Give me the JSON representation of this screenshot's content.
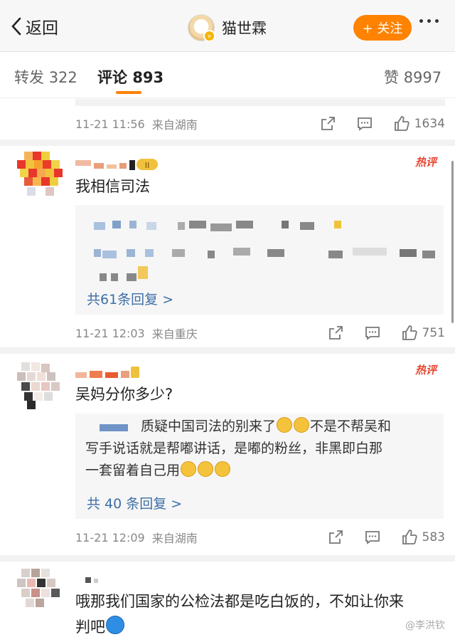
{
  "header": {
    "back_label": "返回",
    "user_name": "猫世霖",
    "follow_label": "+ 关注"
  },
  "tabs": {
    "repost_label": "转发",
    "repost_count": "322",
    "comment_label": "评论",
    "comment_count": "893",
    "like_label": "赞",
    "like_count": "8997"
  },
  "prev_comment": {
    "date": "11-21 11:56",
    "source": "来自湖南",
    "likes": "1634"
  },
  "comments": [
    {
      "text": "我相信司法",
      "hot_label": "热评",
      "reply_more": "共61条回复 >",
      "date": "11-21 12:03",
      "source": "来自重庆",
      "likes": "751"
    },
    {
      "text": "吴妈分你多少?",
      "hot_label": "热评",
      "reply_text_1": "质疑中国司法的别来了",
      "reply_text_2": "不是不帮吴和",
      "reply_text_3": "写手说话就是帮嘟讲话，是嘟的粉丝，非黑即白那",
      "reply_text_4": "一套留着自己用",
      "reply_more": "共 40 条回复 >",
      "date": "11-21 12:09",
      "source": "来自湖南",
      "likes": "583"
    },
    {
      "text_line1": "哦那我们国家的公检法都是吃白饭的，不如让你来",
      "text_line2": "判吧"
    }
  ],
  "watermark": "@李洪钦",
  "colors": {
    "accent": "#ff8200",
    "link": "#3d6fa6",
    "hot": "#e8452f"
  }
}
